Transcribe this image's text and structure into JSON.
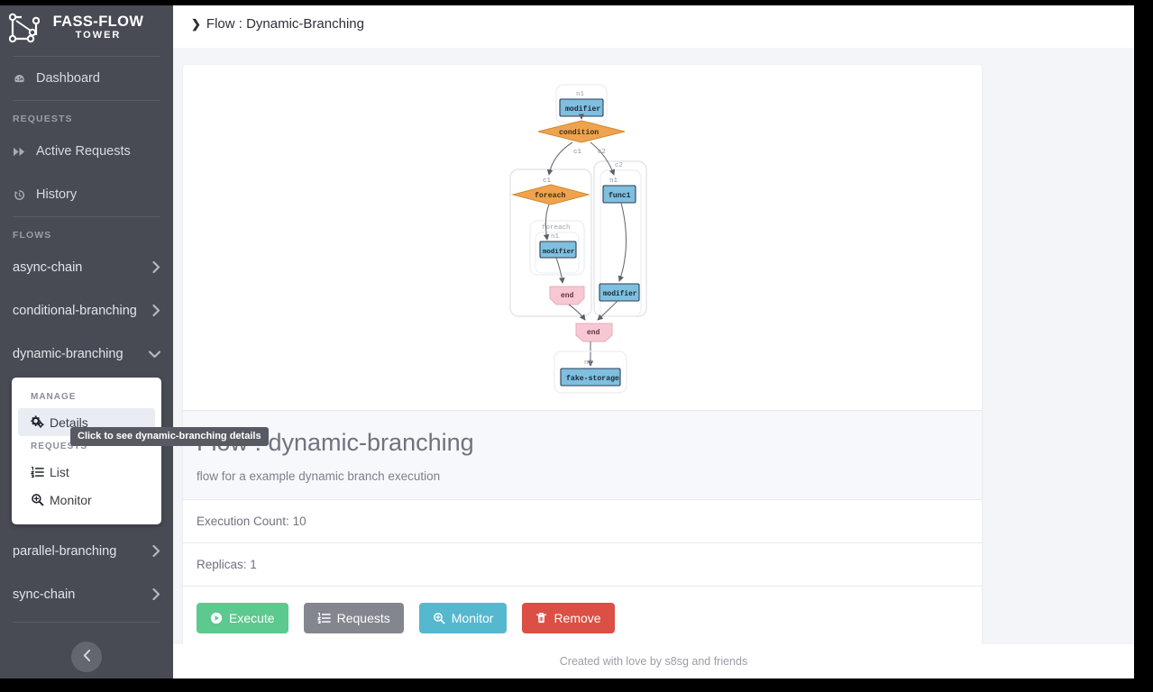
{
  "sidebar": {
    "brand": {
      "title": "FASS-FLOW",
      "subtitle": "TOWER",
      "logo_icon": "flow-graph-logo-icon"
    },
    "dashboard": {
      "label": "Dashboard",
      "icon": "tachometer-icon"
    },
    "sections": [
      {
        "title": "REQUESTS"
      },
      {
        "title": "FLOWS"
      }
    ],
    "requests_items": [
      {
        "label": "Active Requests",
        "icon": "forward-arrows-icon"
      },
      {
        "label": "History",
        "icon": "history-clock-icon"
      }
    ],
    "flows": [
      {
        "label": "async-chain",
        "expanded": false,
        "chevron": "chevron-right-icon"
      },
      {
        "label": "conditional-branching",
        "expanded": false,
        "chevron": "chevron-right-icon"
      },
      {
        "label": "dynamic-branching",
        "expanded": true,
        "chevron": "chevron-down-icon"
      },
      {
        "label": "parallel-branching",
        "expanded": false,
        "chevron": "chevron-right-icon"
      },
      {
        "label": "sync-chain",
        "expanded": false,
        "chevron": "chevron-right-icon"
      }
    ],
    "submenu": {
      "manage_header": "MANAGE",
      "details_label": "Details",
      "details_icon": "gears-icon",
      "requests_header": "REQUESTS",
      "list_label": "List",
      "list_icon": "list-ol-icon",
      "monitor_label": "Monitor",
      "monitor_icon": "search-plus-icon"
    },
    "collapse_button": {
      "icon": "chevron-left-icon"
    }
  },
  "tooltip": {
    "text": "Click to see dynamic-branching details"
  },
  "topbar": {
    "breadcrumb_caret": "❯",
    "breadcrumb": "Flow : Dynamic-Branching"
  },
  "flow": {
    "title": "Flow : dynamic-branching",
    "description": "flow for a example dynamic branch execution",
    "execution_count_label": "Execution Count: 10",
    "replicas_label": "Replicas: 1"
  },
  "buttons": [
    {
      "label": "Execute",
      "icon": "play-circle-icon",
      "color": "#5cc98e"
    },
    {
      "label": "Requests",
      "icon": "list-ol-icon",
      "color": "#84868f"
    },
    {
      "label": "Monitor",
      "icon": "search-plus-icon",
      "color": "#55b8cf"
    },
    {
      "label": "Remove",
      "icon": "trash-icon",
      "color": "#dc4f44"
    }
  ],
  "footer": {
    "text": "Created with love by s8sg and friends"
  },
  "graph": {
    "colors": {
      "node_fill": "#7fbfe0",
      "node_stroke": "#2c3e50",
      "decision_fill": "#efa34e",
      "decision_stroke": "#c27e2c",
      "end_fill": "#f7c8d4",
      "end_stroke": "#e3a8b8",
      "group_stroke": "#e2e3e8",
      "edge_stroke": "#6b6e78",
      "label_color": "#8a8d96"
    },
    "nodes": [
      {
        "id": "n1_top",
        "label": "modifier",
        "caption": "n1",
        "shape": "box",
        "kind": "node"
      },
      {
        "id": "condition",
        "label": "condition",
        "caption": "",
        "shape": "diamond",
        "kind": "decision"
      },
      {
        "id": "foreach",
        "label": "foreach",
        "caption": "c1",
        "shape": "diamond",
        "kind": "decision"
      },
      {
        "id": "func1",
        "label": "func1",
        "caption": "n1",
        "shape": "box",
        "kind": "node"
      },
      {
        "id": "n1_inner",
        "label": "modifier",
        "caption": "n1",
        "shape": "box",
        "kind": "node"
      },
      {
        "id": "end_c1",
        "label": "end",
        "caption": "",
        "shape": "house",
        "kind": "end"
      },
      {
        "id": "mod_c2",
        "label": "modifier",
        "caption": "",
        "shape": "box",
        "kind": "node"
      },
      {
        "id": "end_main",
        "label": "end",
        "caption": "",
        "shape": "house",
        "kind": "end"
      },
      {
        "id": "storage",
        "label": "fake-storage",
        "caption": "n2",
        "shape": "box",
        "kind": "node"
      }
    ],
    "groups": [
      {
        "id": "g_c1",
        "label": "c1"
      },
      {
        "id": "g_c2",
        "label": "c2"
      },
      {
        "id": "g_foreach",
        "label": "foreach"
      }
    ],
    "edge_labels": [
      "c1",
      "c2",
      "c1"
    ]
  }
}
